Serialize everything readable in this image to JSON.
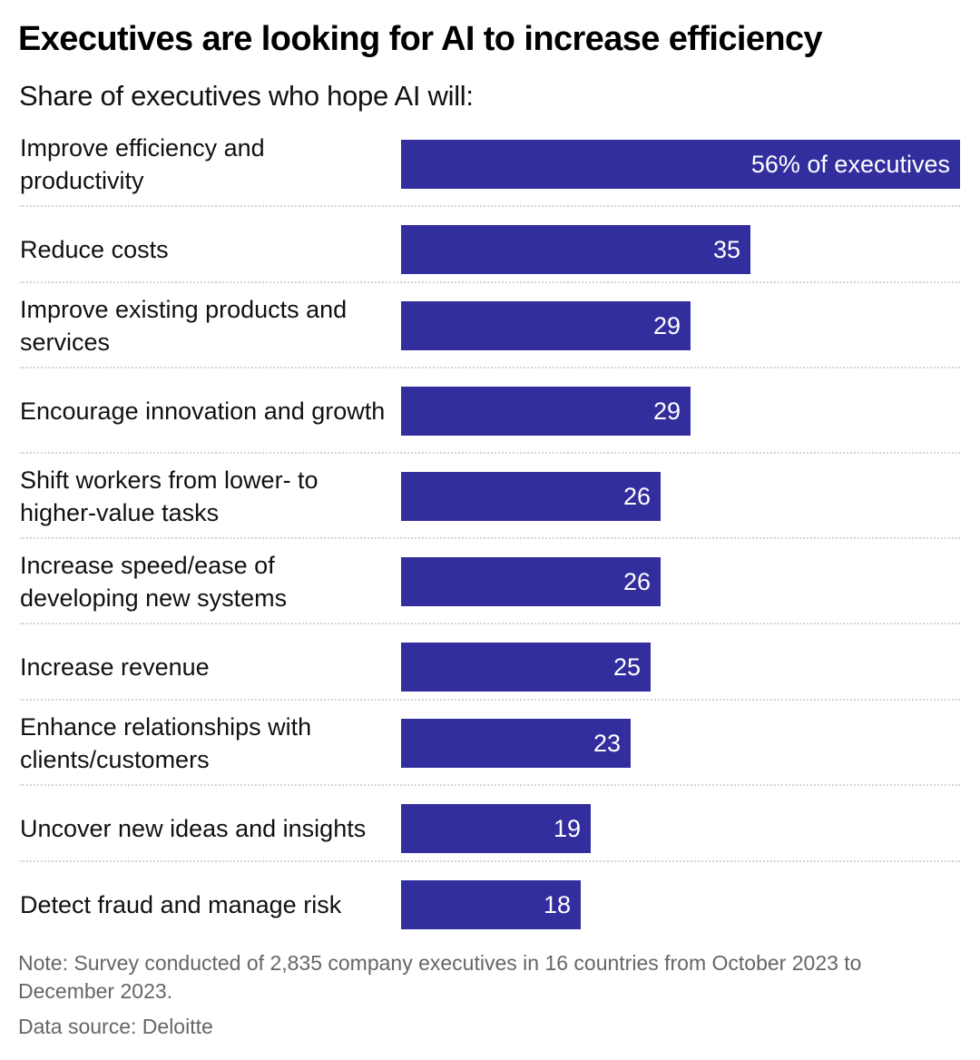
{
  "header": {
    "title": "Executives are looking for AI to increase efficiency",
    "subtitle": "Share of executives who hope AI will:"
  },
  "footer": {
    "note": "Note: Survey conducted of 2,835 company executives in 16 countries from October 2023 to December 2023.",
    "source": "Data source: Deloitte"
  },
  "colors": {
    "bar": "#332e9e",
    "bar_label": "#ffffff",
    "separator": "#d5d5d5"
  },
  "chart_data": {
    "type": "bar",
    "orientation": "horizontal",
    "title": "Executives are looking for AI to increase efficiency",
    "subtitle": "Share of executives who hope AI will:",
    "xlabel": "",
    "ylabel": "",
    "unit": "% of executives",
    "xlim": [
      0,
      56
    ],
    "grid": false,
    "legend": "none",
    "categories": [
      "Improve efficiency and productivity",
      "Reduce costs",
      "Improve existing products and services",
      "Encourage innovation and growth",
      "Shift workers from lower- to higher-value tasks",
      "Increase speed/ease of developing new systems",
      "Increase revenue",
      "Enhance relationships with clients/customers",
      "Uncover new ideas and insights",
      "Detect fraud and manage risk"
    ],
    "values": [
      56,
      35,
      29,
      29,
      26,
      26,
      25,
      23,
      19,
      18
    ],
    "data_labels": [
      "56% of executives",
      "35",
      "29",
      "29",
      "26",
      "26",
      "25",
      "23",
      "19",
      "18"
    ]
  }
}
